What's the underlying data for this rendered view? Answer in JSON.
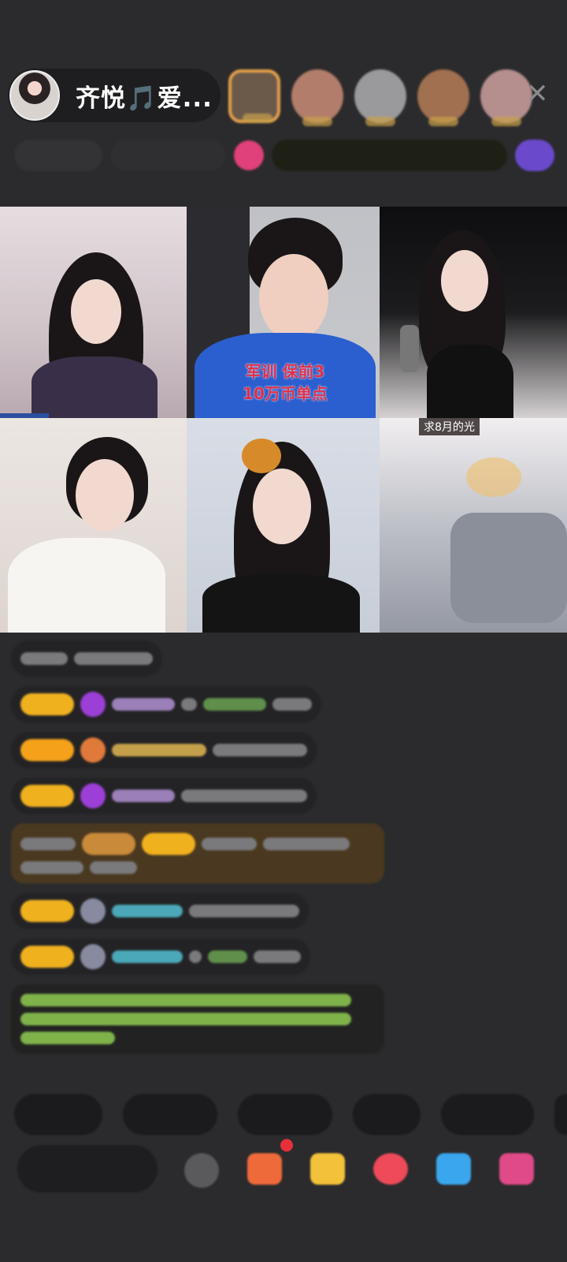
{
  "header": {
    "host_name": "齐悦🎵爱...",
    "close_icon": "close-icon"
  },
  "video_grid": {
    "cells": [
      {
        "id": "seat-1"
      },
      {
        "id": "seat-2",
        "overlay_line1": "军训 保前3",
        "overlay_line2": "10万币单点"
      },
      {
        "id": "seat-3"
      },
      {
        "id": "seat-4"
      },
      {
        "id": "seat-5"
      },
      {
        "id": "seat-6",
        "tag": "求8月的光"
      }
    ]
  },
  "colors": {
    "background": "#2b2b2d",
    "level_badge": "#f0b11f",
    "overlay_text": "#e0304a",
    "close_icon": "#8a8a8c"
  },
  "icons": [
    "close-icon",
    "gift-icon",
    "lucky-bag-icon",
    "game-icon",
    "pk-icon",
    "fans-icon",
    "more-icon"
  ]
}
